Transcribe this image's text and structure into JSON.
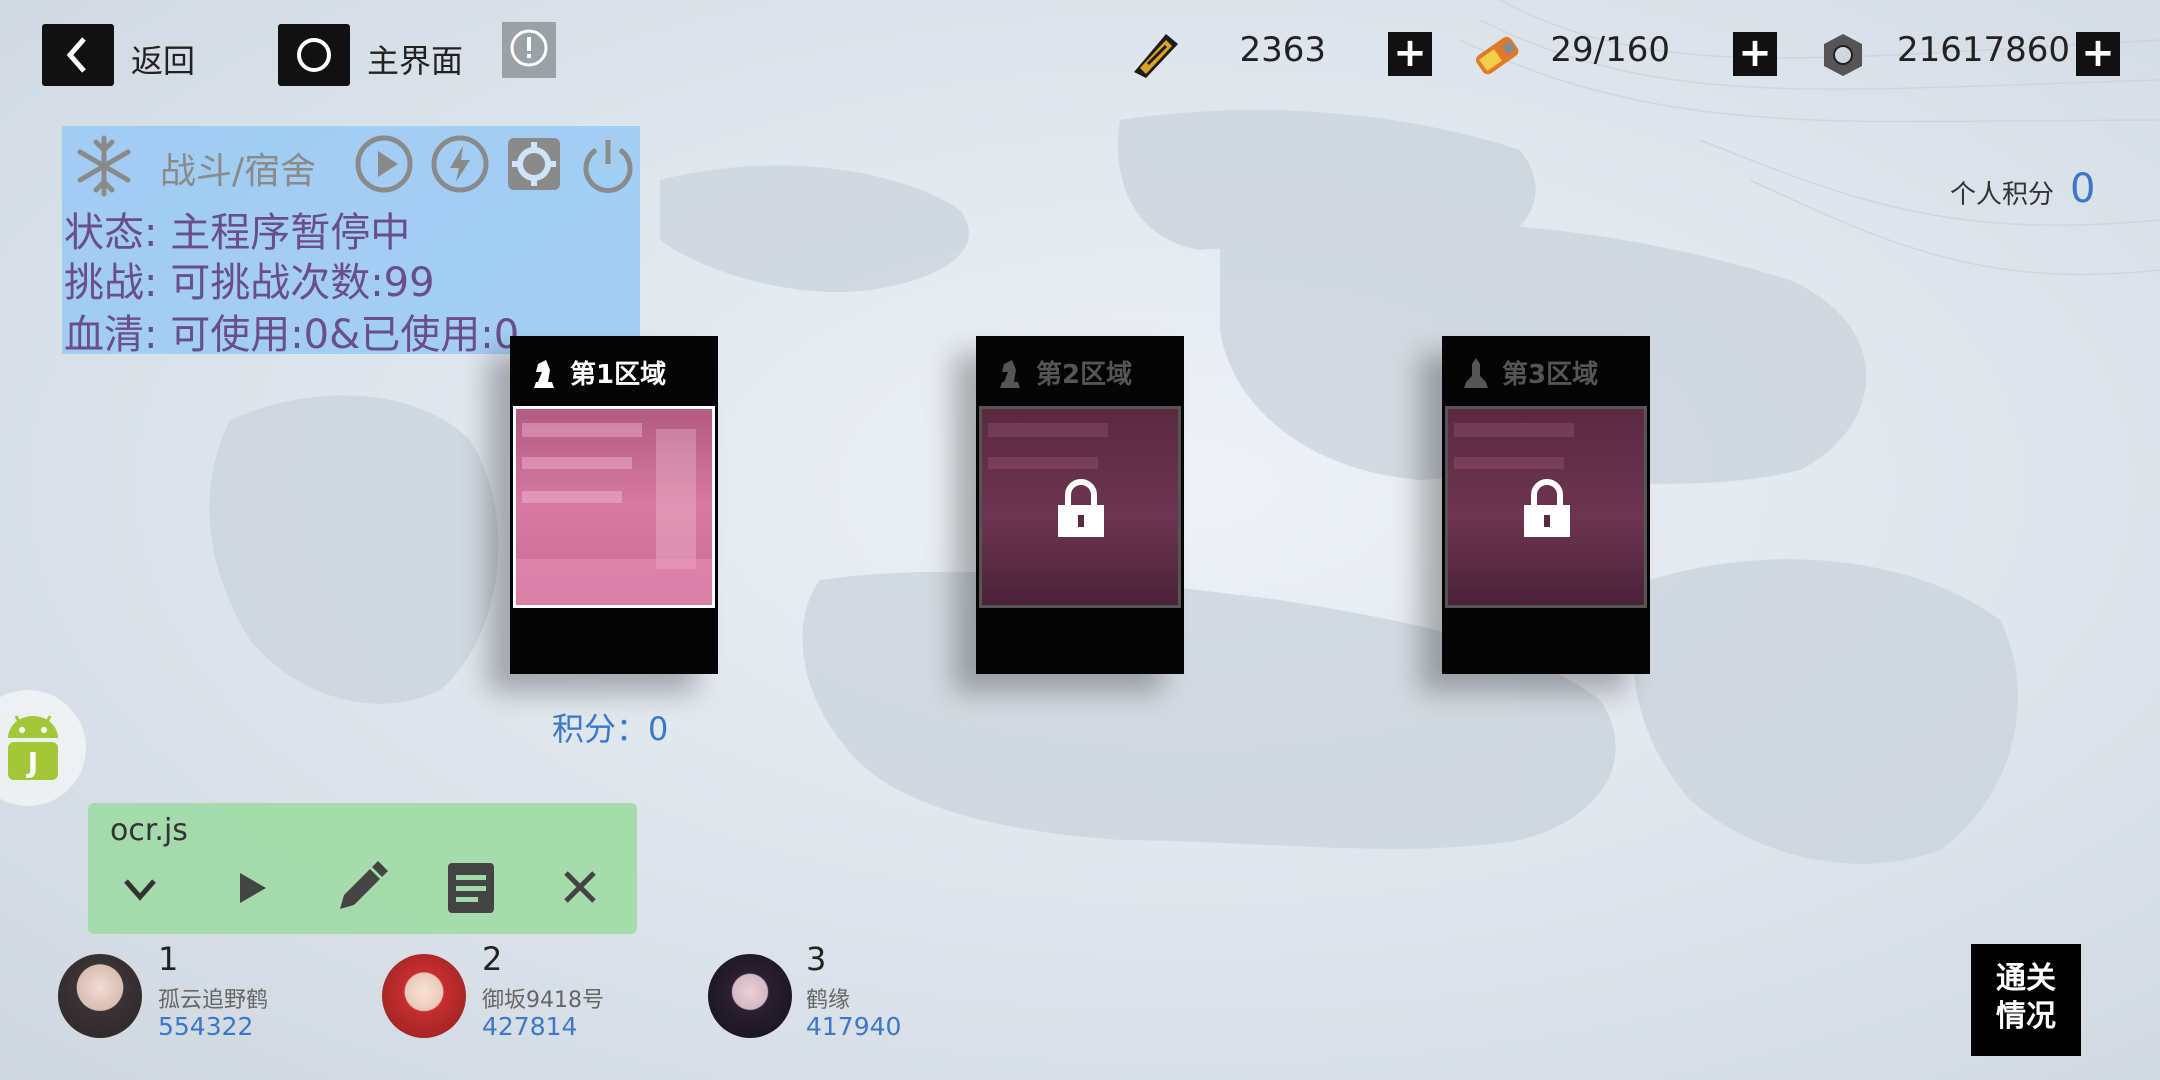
{
  "topbar": {
    "back_label": "返回",
    "home_label": "主界面",
    "resources": [
      {
        "icon": "ammo-clip-icon",
        "value": "2363"
      },
      {
        "icon": "battery-canister-icon",
        "value": "29/160"
      },
      {
        "icon": "hex-nut-icon",
        "value": "21617860"
      }
    ],
    "plus": "+"
  },
  "personal_score": {
    "label": "个人积分",
    "value": "0"
  },
  "script_panel": {
    "title": "战斗/宿舍",
    "status": "状态: 主程序暂停中",
    "challenge": "挑战: 可挑战次数:99",
    "serum": "血清: 可使用:0&已使用:0"
  },
  "areas": [
    {
      "title": "第1区域",
      "locked": false
    },
    {
      "title": "第2区域",
      "locked": true
    },
    {
      "title": "第3区域",
      "locked": true
    }
  ],
  "area_score": "积分：0",
  "ocr_panel": {
    "filename": "ocr.js"
  },
  "ranking": [
    {
      "rank": "1",
      "name": "孤云追野鹤",
      "score": "554322"
    },
    {
      "rank": "2",
      "name": "御坂9418号",
      "score": "427814"
    },
    {
      "rank": "3",
      "name": "鹤缘",
      "score": "417940"
    }
  ],
  "clear_status_button": {
    "line1": "通关",
    "line2": "情况"
  },
  "colors": {
    "accent_blue": "#3a78c8",
    "panel_blue": "#96c8f5",
    "panel_green": "#a0daa5",
    "panel_text": "#6a4e88"
  }
}
